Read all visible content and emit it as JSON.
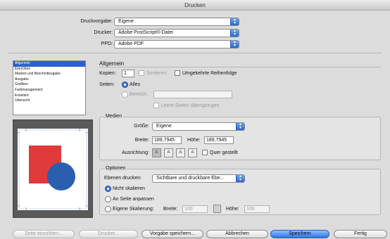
{
  "window": {
    "title": "Drucken"
  },
  "top": {
    "preset_label": "Druckvorgabe:",
    "preset_value": "Eigene",
    "printer_label": "Drucker:",
    "printer_value": "Adobe PostScript®-Datei",
    "ppd_label": "PPD:",
    "ppd_value": "Adobe PDF"
  },
  "sidebar": {
    "items": [
      {
        "label": "Allgemein",
        "selected": true
      },
      {
        "label": "Einrichten"
      },
      {
        "label": "Marken und Beschnittzugabe"
      },
      {
        "label": "Ausgabe"
      },
      {
        "label": "Grafiken"
      },
      {
        "label": "Farbmanagement"
      },
      {
        "label": "Erweitert"
      },
      {
        "label": "Übersicht"
      }
    ]
  },
  "general": {
    "header": "Allgemein",
    "copies_label": "Kopien:",
    "copies_value": "1",
    "sort_label": "Sortieren",
    "reverse_label": "Umgekehrte Reihenfolge",
    "pages_label": "Seiten:",
    "all_label": "Alles",
    "range_label": "Bereich:",
    "skip_blank_label": "Leere Seiten überspringen"
  },
  "media": {
    "header": "Medien",
    "size_label": "Größe:",
    "size_value": "Eigene",
    "width_label": "Breite:",
    "width_value": "189,7945",
    "height_label": "Höhe:",
    "height_value": "189,7945",
    "orientation_label": "Ausrichtung:",
    "orientation_glyphs": [
      "A",
      "A",
      "A",
      "A"
    ],
    "transverse_label": "Quer gestellt"
  },
  "options": {
    "header": "Optionen",
    "layers_label": "Ebenen drucken:",
    "layers_value": "Sichtbare und druckbare Ebe...",
    "no_scale_label": "Nicht skalieren",
    "fit_page_label": "An Seite anpassen",
    "custom_scale_label": "Eigene Skalierung:",
    "scale_width_label": "Breite:",
    "scale_width_value": "100",
    "scale_height_label": "Höhe:",
    "scale_height_value": "100"
  },
  "buttons": {
    "page_setup": "Seite einrichten...",
    "printer": "Drucker...",
    "save_preset": "Vorgabe speichern...",
    "cancel": "Abbrechen",
    "save": "Speichern",
    "done": "Fertig"
  },
  "colors": {
    "accent": "#2d5fd4",
    "preview_red": "#e03a3a",
    "preview_blue": "#2a5fb0"
  }
}
